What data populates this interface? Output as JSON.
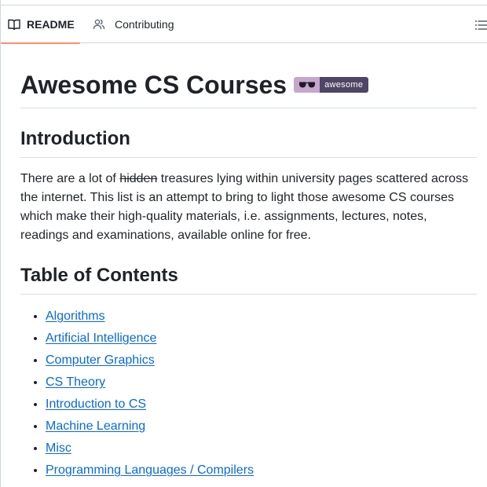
{
  "tabs": {
    "readme": "README",
    "contributing": "Contributing"
  },
  "readme": {
    "title": "Awesome CS Courses",
    "badge": {
      "label": "awesome",
      "left_color": "#c7a6cb",
      "right_color": "#4f4564"
    },
    "introduction": {
      "heading": "Introduction",
      "text_before": "There are a lot of ",
      "struck_word": "hidden",
      "text_after": " treasures lying within university pages scattered across the internet. This list is an attempt to bring to light those awesome CS courses which make their high-quality materials, i.e. assignments, lectures, notes, readings and examinations, available online for free."
    },
    "toc": {
      "heading": "Table of Contents",
      "items": [
        "Algorithms",
        "Artificial Intelligence",
        "Computer Graphics",
        "CS Theory",
        "Introduction to CS",
        "Machine Learning",
        "Misc",
        "Programming Languages / Compilers"
      ]
    }
  },
  "colors": {
    "link": "#0969da",
    "active_tab_underline": "#fd8c73",
    "border": "#d0d7de"
  },
  "icons": {
    "readme_tab": "book-icon",
    "contributing_tab": "people-icon",
    "outline": "list-unordered-icon",
    "badge": "sunglasses-icon"
  }
}
